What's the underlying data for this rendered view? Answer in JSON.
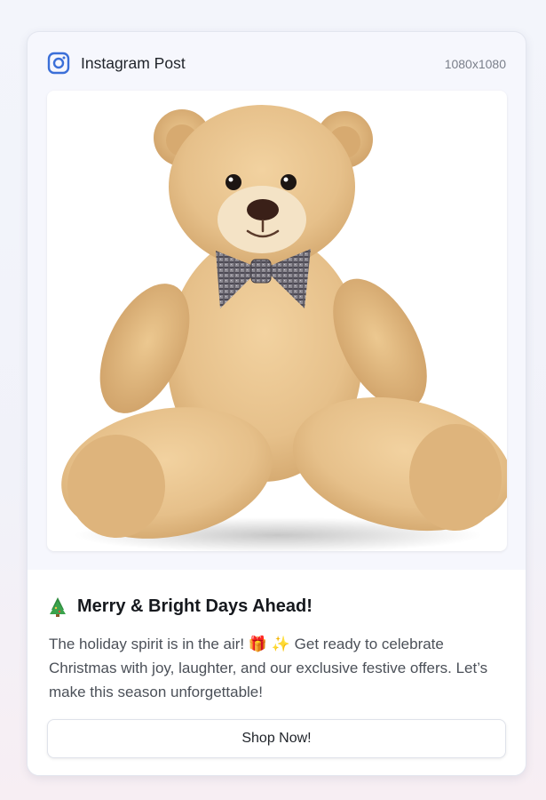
{
  "post": {
    "platform_label": "Instagram Post",
    "dimensions": "1080x1080",
    "image_alt": "Teddy bear with plaid bow tie",
    "headline": "Merry & Bright Days Ahead!",
    "headline_icon": "christmas-tree",
    "caption": "The holiday spirit is in the air! 🎁 ✨ Get ready to celebrate Christmas with joy, laughter, and our exclusive festive offers. Let’s make this season unforgettable!",
    "cta_label": "Shop Now!"
  },
  "colors": {
    "accent": "#3b6fd8",
    "bear_fur": "#e8c48d",
    "tree": "#2f8a3e"
  }
}
